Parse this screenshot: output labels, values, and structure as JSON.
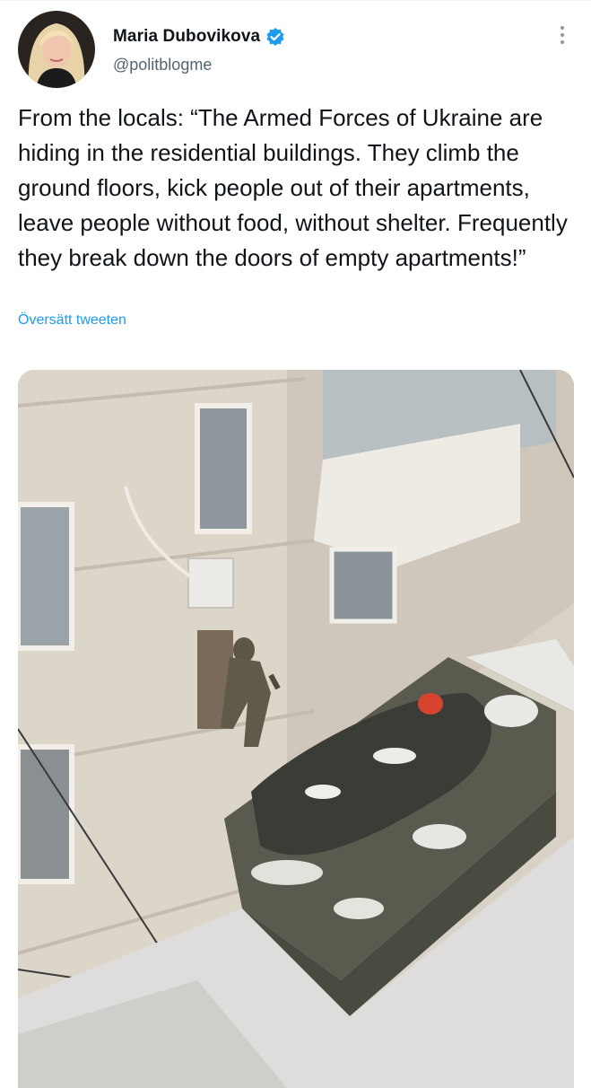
{
  "tweet": {
    "author_name": "Maria Dubovikova",
    "author_handle": "@politblogme",
    "text": "From the locals: “The Armed Forces of Ukraine are hiding in the residential buildings. They climb the ground floors, kick people out of their apartments, leave people without food, without shelter. Frequently they break down the doors of empty apartments!”",
    "translate_label": "Översätt tweeten",
    "verified": true
  },
  "icons": {
    "verified": "verified-badge-icon",
    "more": "more-options-icon"
  },
  "colors": {
    "accent": "#1d9bf0",
    "secondary_text": "#536471",
    "primary_text": "#0f1419"
  }
}
